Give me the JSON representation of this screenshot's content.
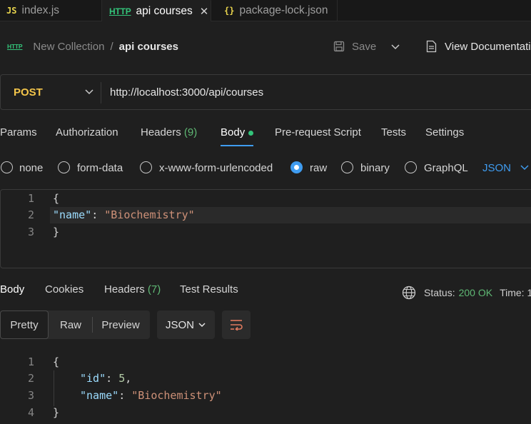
{
  "tabs": [
    {
      "icon": "JS",
      "label": "index.js"
    },
    {
      "icon": "HTTP",
      "label": "api courses"
    },
    {
      "icon": "{}",
      "label": "package-lock.json"
    }
  ],
  "breadcrumb": {
    "icon": "HTTP",
    "collection": "New Collection",
    "separator": "/",
    "request": "api courses"
  },
  "toolbar": {
    "save_label": "Save",
    "view_docs_label": "View Documentation"
  },
  "request": {
    "method": "POST",
    "url": "http://localhost:3000/api/courses"
  },
  "request_tabs": [
    {
      "label": "Params"
    },
    {
      "label": "Authorization"
    },
    {
      "label": "Headers",
      "count": "(9)"
    },
    {
      "label": "Body"
    },
    {
      "label": "Pre-request Script"
    },
    {
      "label": "Tests"
    },
    {
      "label": "Settings"
    }
  ],
  "body_types": [
    "none",
    "form-data",
    "x-www-form-urlencoded",
    "raw",
    "binary",
    "GraphQL"
  ],
  "body_type_selected": "raw",
  "body_format": "JSON",
  "request_body": {
    "line_numbers": [
      "1",
      "2",
      "3"
    ],
    "open_brace": "{",
    "key": "\"name\"",
    "colon": ": ",
    "value": "\"Biochemistry\"",
    "close_brace": "}"
  },
  "response_tabs": [
    {
      "label": "Body"
    },
    {
      "label": "Cookies"
    },
    {
      "label": "Headers",
      "count": "(7)"
    },
    {
      "label": "Test Results"
    }
  ],
  "status": {
    "label": "Status:",
    "value": "200 OK",
    "time_label": "Time: 1"
  },
  "view_modes": [
    "Pretty",
    "Raw",
    "Preview"
  ],
  "response_format": "JSON",
  "response_body": {
    "line_numbers": [
      "1",
      "2",
      "3",
      "4"
    ],
    "open_brace": "{",
    "id_key": "\"id\"",
    "id_value": "5",
    "name_key": "\"name\"",
    "name_value": "\"Biochemistry\"",
    "close_brace": "}"
  },
  "colors": {
    "accent": "#3f9cf0",
    "method": "#f3c54a",
    "success": "#5fb874",
    "background": "#1f1f1f"
  }
}
